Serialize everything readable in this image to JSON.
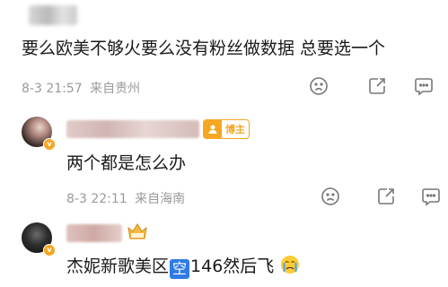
{
  "comment1": {
    "text": "要么欧美不够火要么没有粉丝做数据 总要选一个",
    "date": "8-3 21:57",
    "location": "来自贵州"
  },
  "reply1": {
    "badge": "博主",
    "text": "两个都是怎么办",
    "date": "8-3 22:11",
    "location": "来自海南"
  },
  "reply2": {
    "text_before": "杰妮新歌美区",
    "kong": "空",
    "text_after": "146然后飞",
    "emoji": "crying-face"
  },
  "icons": {
    "dislike": "sad-face-icon",
    "share": "share-icon",
    "comment": "comment-icon",
    "like": "thumbs-up-icon"
  },
  "colors": {
    "badge_orange": "#f5a623",
    "kong_blue": "#2f7be5",
    "meta_gray": "#9a9a9a"
  }
}
